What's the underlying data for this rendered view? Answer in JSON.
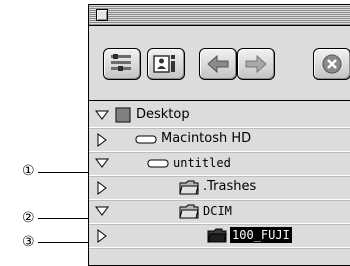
{
  "callouts": [
    {
      "number": "①",
      "target": "untitled"
    },
    {
      "number": "②",
      "target": "DCIM"
    },
    {
      "number": "③",
      "target": "100_FUJI"
    }
  ],
  "toolbar": {
    "buttons": [
      {
        "name": "view-options-icon"
      },
      {
        "name": "get-info-icon"
      },
      {
        "name": "back-icon"
      },
      {
        "name": "forward-icon"
      },
      {
        "name": "stop-icon"
      }
    ]
  },
  "list": {
    "items": [
      {
        "label": "Desktop",
        "icon": "desktop-icon",
        "disclosure": "expanded"
      },
      {
        "label": "Macintosh HD",
        "icon": "hard-disk-icon",
        "disclosure": "collapsed"
      },
      {
        "label": "untitled",
        "icon": "disk-icon",
        "disclosure": "expanded"
      },
      {
        "label": ".Trashes",
        "icon": "folder-icon",
        "disclosure": "collapsed"
      },
      {
        "label": "DCIM",
        "icon": "folder-icon",
        "disclosure": "expanded"
      },
      {
        "label": "100_FUJI",
        "icon": "folder-icon",
        "disclosure": "collapsed",
        "selected": true
      }
    ]
  },
  "colors": {
    "window_bg": "#dcdcdc",
    "selection": "#000000",
    "selection_text": "#ffffff"
  }
}
